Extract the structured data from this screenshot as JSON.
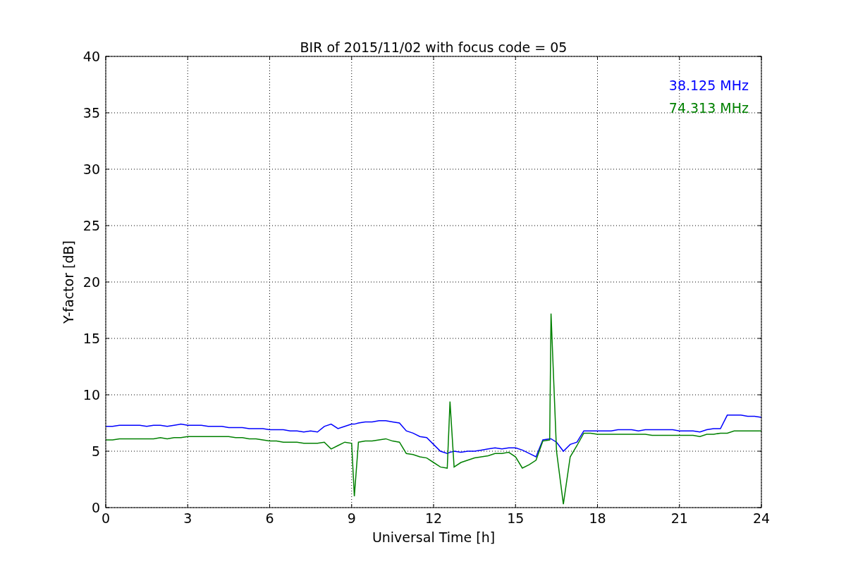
{
  "chart_data": {
    "type": "line",
    "title": "BIR of 2015/11/02 with focus code = 05",
    "xlabel": "Universal Time [h]",
    "ylabel": "Y-factor [dB]",
    "xlim": [
      0,
      24
    ],
    "ylim": [
      0,
      40
    ],
    "xticks": [
      0,
      3,
      6,
      9,
      12,
      15,
      18,
      21,
      24
    ],
    "yticks": [
      0,
      5,
      10,
      15,
      20,
      25,
      30,
      35,
      40
    ],
    "grid": true,
    "x": [
      0,
      0.25,
      0.5,
      0.75,
      1,
      1.25,
      1.5,
      1.75,
      2,
      2.25,
      2.5,
      2.75,
      3,
      3.25,
      3.5,
      3.75,
      4,
      4.25,
      4.5,
      4.75,
      5,
      5.25,
      5.5,
      5.75,
      6,
      6.25,
      6.5,
      6.75,
      7,
      7.25,
      7.5,
      7.75,
      8,
      8.25,
      8.5,
      8.75,
      9,
      9.1,
      9.25,
      9.5,
      9.75,
      10,
      10.25,
      10.5,
      10.75,
      11,
      11.25,
      11.5,
      11.75,
      12,
      12.25,
      12.5,
      12.6,
      12.75,
      13,
      13.25,
      13.5,
      13.75,
      14,
      14.25,
      14.5,
      14.75,
      15,
      15.25,
      15.5,
      15.75,
      16,
      16.25,
      16.3,
      16.5,
      16.75,
      17,
      17.25,
      17.5,
      17.75,
      18,
      18.25,
      18.5,
      18.75,
      19,
      19.25,
      19.5,
      19.75,
      20,
      20.25,
      20.5,
      20.75,
      21,
      21.25,
      21.5,
      21.75,
      22,
      22.25,
      22.5,
      22.75,
      23,
      23.25,
      23.5,
      23.75,
      24
    ],
    "series": [
      {
        "name": "38.125 MHz",
        "color": "#0000ff",
        "values": [
          7.2,
          7.2,
          7.3,
          7.3,
          7.3,
          7.3,
          7.2,
          7.3,
          7.3,
          7.2,
          7.3,
          7.4,
          7.3,
          7.3,
          7.3,
          7.2,
          7.2,
          7.2,
          7.1,
          7.1,
          7.1,
          7.0,
          7.0,
          7.0,
          6.9,
          6.9,
          6.9,
          6.8,
          6.8,
          6.7,
          6.8,
          6.7,
          7.2,
          7.4,
          7.0,
          7.2,
          7.4,
          7.4,
          7.5,
          7.6,
          7.6,
          7.7,
          7.7,
          7.6,
          7.5,
          6.8,
          6.6,
          6.3,
          6.2,
          5.6,
          5.0,
          4.8,
          4.9,
          5.0,
          4.9,
          5.0,
          5.0,
          5.1,
          5.2,
          5.3,
          5.2,
          5.3,
          5.3,
          5.1,
          4.8,
          4.5,
          6.0,
          6.1,
          6.1,
          5.8,
          5.0,
          5.6,
          5.8,
          6.8,
          6.8,
          6.8,
          6.8,
          6.8,
          6.9,
          6.9,
          6.9,
          6.8,
          6.9,
          6.9,
          6.9,
          6.9,
          6.9,
          6.8,
          6.8,
          6.8,
          6.7,
          6.9,
          7.0,
          7.0,
          8.2,
          8.2,
          8.2,
          8.1,
          8.1,
          8.0
        ]
      },
      {
        "name": "74.313 MHz",
        "color": "#008000",
        "values": [
          6.0,
          6.0,
          6.1,
          6.1,
          6.1,
          6.1,
          6.1,
          6.1,
          6.2,
          6.1,
          6.2,
          6.2,
          6.3,
          6.3,
          6.3,
          6.3,
          6.3,
          6.3,
          6.3,
          6.2,
          6.2,
          6.1,
          6.1,
          6.0,
          5.9,
          5.9,
          5.8,
          5.8,
          5.8,
          5.7,
          5.7,
          5.7,
          5.8,
          5.2,
          5.5,
          5.8,
          5.7,
          1.0,
          5.8,
          5.9,
          5.9,
          6.0,
          6.1,
          5.9,
          5.8,
          4.8,
          4.7,
          4.5,
          4.4,
          4.0,
          3.6,
          3.5,
          9.4,
          3.6,
          4.0,
          4.2,
          4.4,
          4.5,
          4.6,
          4.8,
          4.8,
          4.9,
          4.5,
          3.5,
          3.8,
          4.2,
          5.9,
          6.0,
          17.2,
          5.0,
          0.3,
          4.5,
          5.5,
          6.6,
          6.6,
          6.5,
          6.5,
          6.5,
          6.5,
          6.5,
          6.5,
          6.5,
          6.5,
          6.4,
          6.4,
          6.4,
          6.4,
          6.4,
          6.4,
          6.4,
          6.3,
          6.5,
          6.5,
          6.6,
          6.6,
          6.8,
          6.8,
          6.8,
          6.8,
          6.8
        ]
      }
    ]
  }
}
